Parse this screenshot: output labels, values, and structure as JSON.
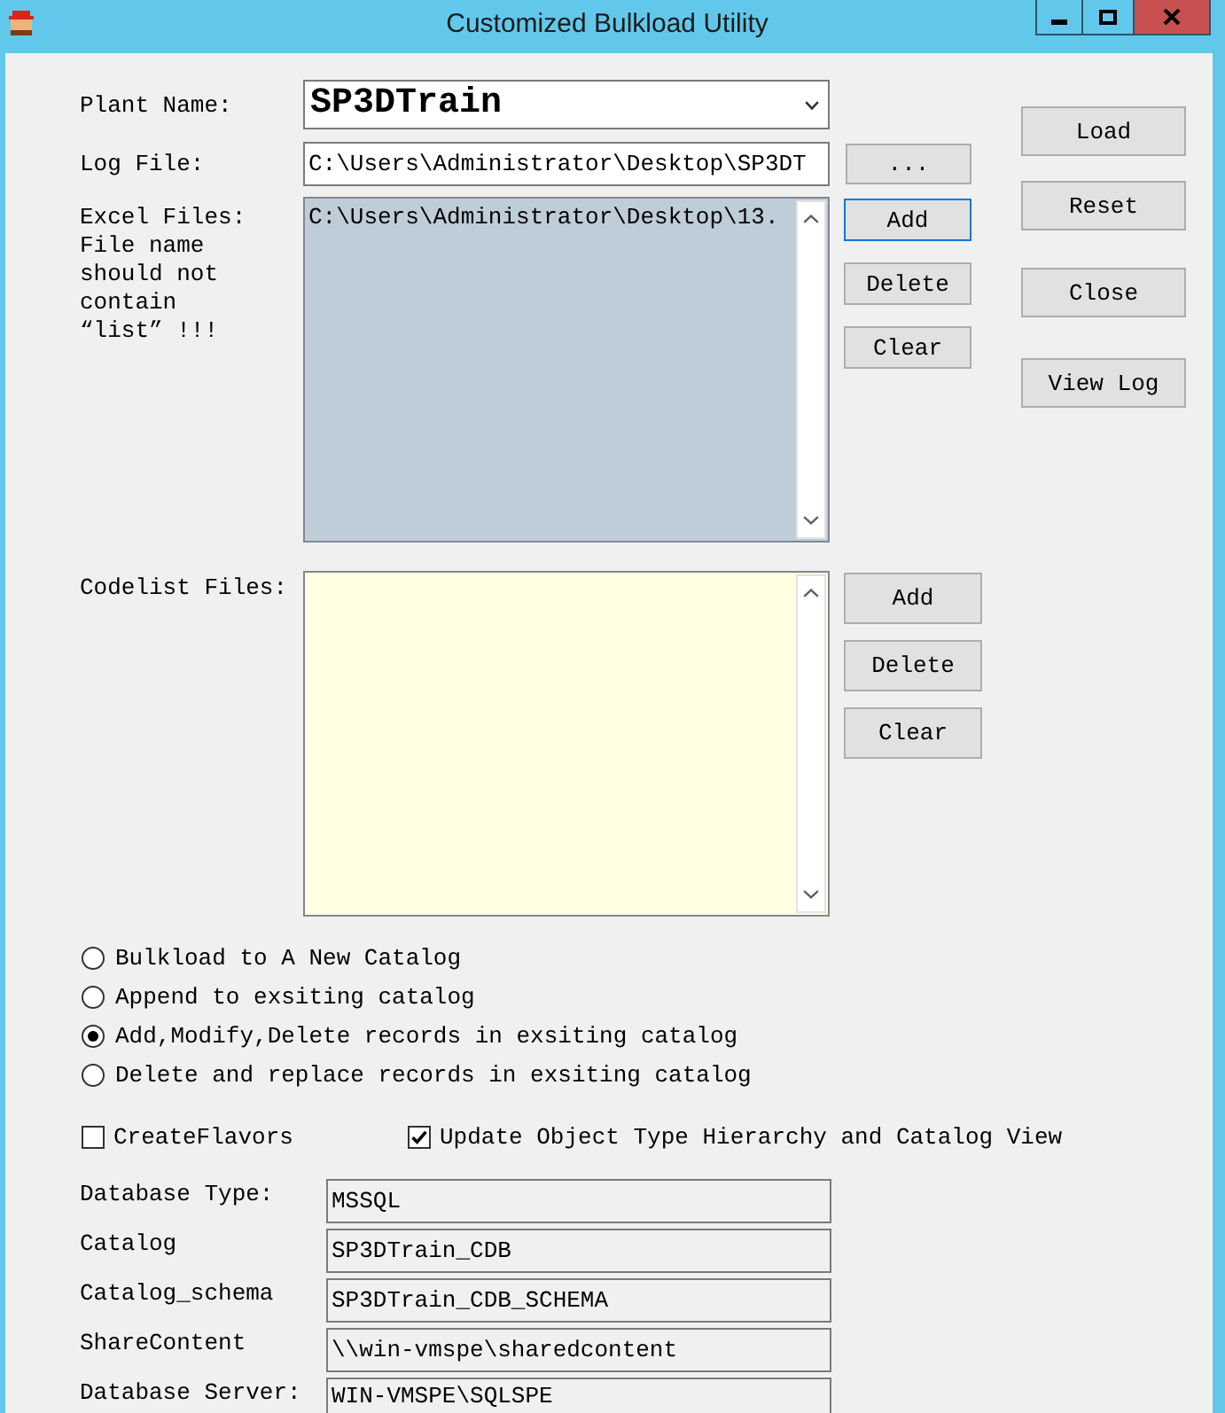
{
  "window": {
    "title": "Customized Bulkload Utility"
  },
  "plant_name": {
    "label": "Plant Name:",
    "value": "SP3DTrain"
  },
  "log_file": {
    "label": "Log File:",
    "value": "C:\\Users\\Administrator\\Desktop\\SP3DT",
    "browse_button": {
      "label": "...",
      "focused": false
    }
  },
  "excel_files": {
    "label": "Excel Files: File name should not contain “list” !!!",
    "items": [
      "C:\\Users\\Administrator\\Desktop\\13."
    ],
    "buttons": [
      {
        "label": "Add",
        "focused": true
      },
      {
        "label": "Delete",
        "focused": false
      },
      {
        "label": "Clear",
        "focused": false
      }
    ]
  },
  "codelist_files": {
    "label": "Codelist Files:",
    "buttons": [
      {
        "label": "Add",
        "focused": false
      },
      {
        "label": "Delete",
        "focused": false
      },
      {
        "label": "Clear",
        "focused": false
      }
    ]
  },
  "action_buttons": [
    {
      "label": "Load",
      "focused": false
    },
    {
      "label": "Reset",
      "focused": false
    },
    {
      "label": "Close",
      "focused": false
    },
    {
      "label": "View Log",
      "focused": false
    }
  ],
  "load_options": [
    {
      "label": "Bulkload to A New Catalog",
      "selected": false
    },
    {
      "label": "Append to exsiting catalog",
      "selected": false
    },
    {
      "label": "Add,Modify,Delete records in exsiting catalog",
      "selected": true
    },
    {
      "label": "Delete and replace records in exsiting catalog",
      "selected": false
    }
  ],
  "checkboxes": [
    {
      "label": "CreateFlavors",
      "checked": false
    },
    {
      "label": "Update Object Type Hierarchy and Catalog View",
      "checked": true
    }
  ],
  "database_fields": [
    {
      "label": "Database Type:",
      "value": "MSSQL"
    },
    {
      "label": "Catalog",
      "value": "SP3DTrain_CDB"
    },
    {
      "label": "Catalog_schema",
      "value": "SP3DTrain_CDB_SCHEMA"
    },
    {
      "label": "ShareContent",
      "value": "\\\\win-vmspe\\sharedcontent"
    },
    {
      "label": "Database Server:",
      "value": "WIN-VMSPE\\SQLSPE"
    }
  ]
}
